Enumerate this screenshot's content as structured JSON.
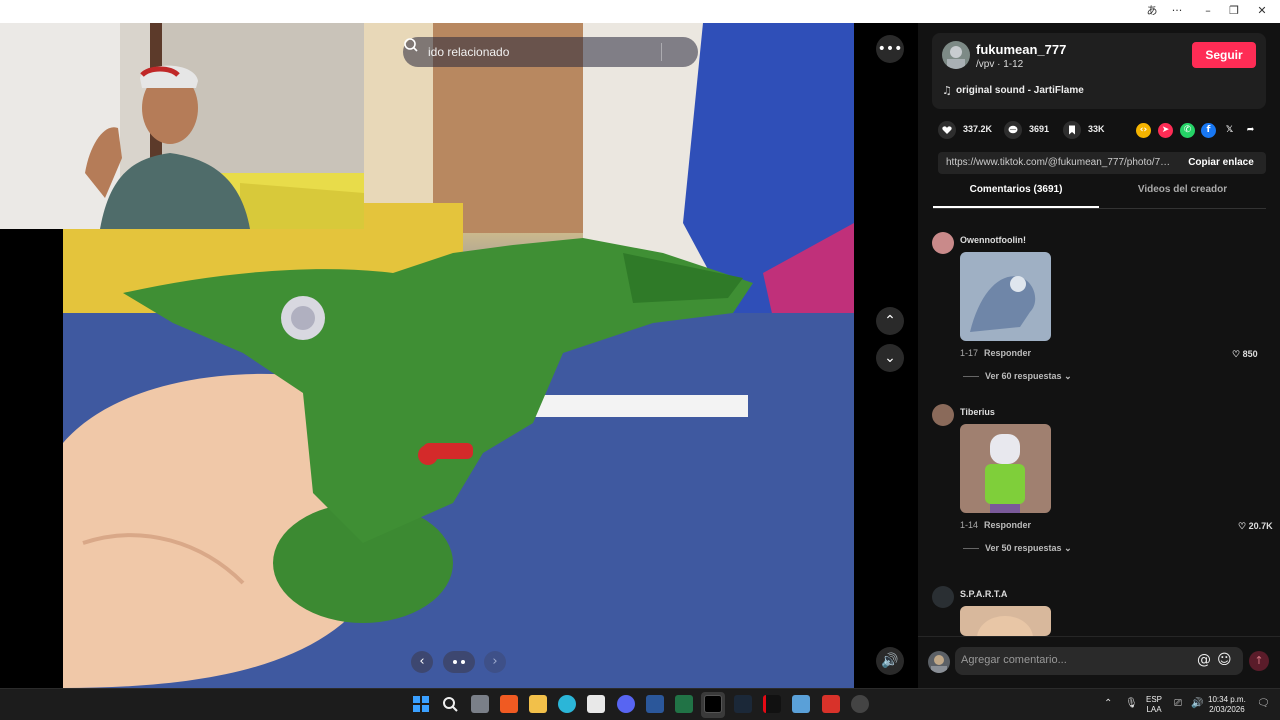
{
  "search": {
    "placeholder_partial": "ido relacionado"
  },
  "author": {
    "username": "fukumean_777",
    "subtitle": "/vpv · 1-12",
    "follow_label": "Seguir",
    "sound": "original sound - JartiFlame"
  },
  "stats": {
    "likes": "337.2K",
    "comments": "3691",
    "saves": "33K"
  },
  "share": {
    "url": "https://www.tiktok.com/@fukumean_777/photo/75...",
    "copy_label": "Copiar enlace"
  },
  "tabs": {
    "comments": "Comentarios (3691)",
    "creator_videos": "Videos del creador"
  },
  "comments": [
    {
      "user": "Owennotfoolin!",
      "date": "1-17",
      "reply": "Responder",
      "likes": "850",
      "more": "Ver 60 respuestas"
    },
    {
      "user": "Tiberius",
      "date": "1-14",
      "reply": "Responder",
      "likes": "20.7K",
      "more": "Ver 50 respuestas"
    },
    {
      "user": "S.P.A.R.T.A"
    }
  ],
  "composer": {
    "placeholder": "Agregar comentario..."
  },
  "tray": {
    "lang_line1": "ESP",
    "lang_line2": "LAA",
    "time": "10:34 p.m.",
    "date": "2/03/2026"
  },
  "colors": {
    "follow": "#fe2c55",
    "panel_bg": "#121212",
    "taskbar_bg": "#1c1c1c"
  }
}
